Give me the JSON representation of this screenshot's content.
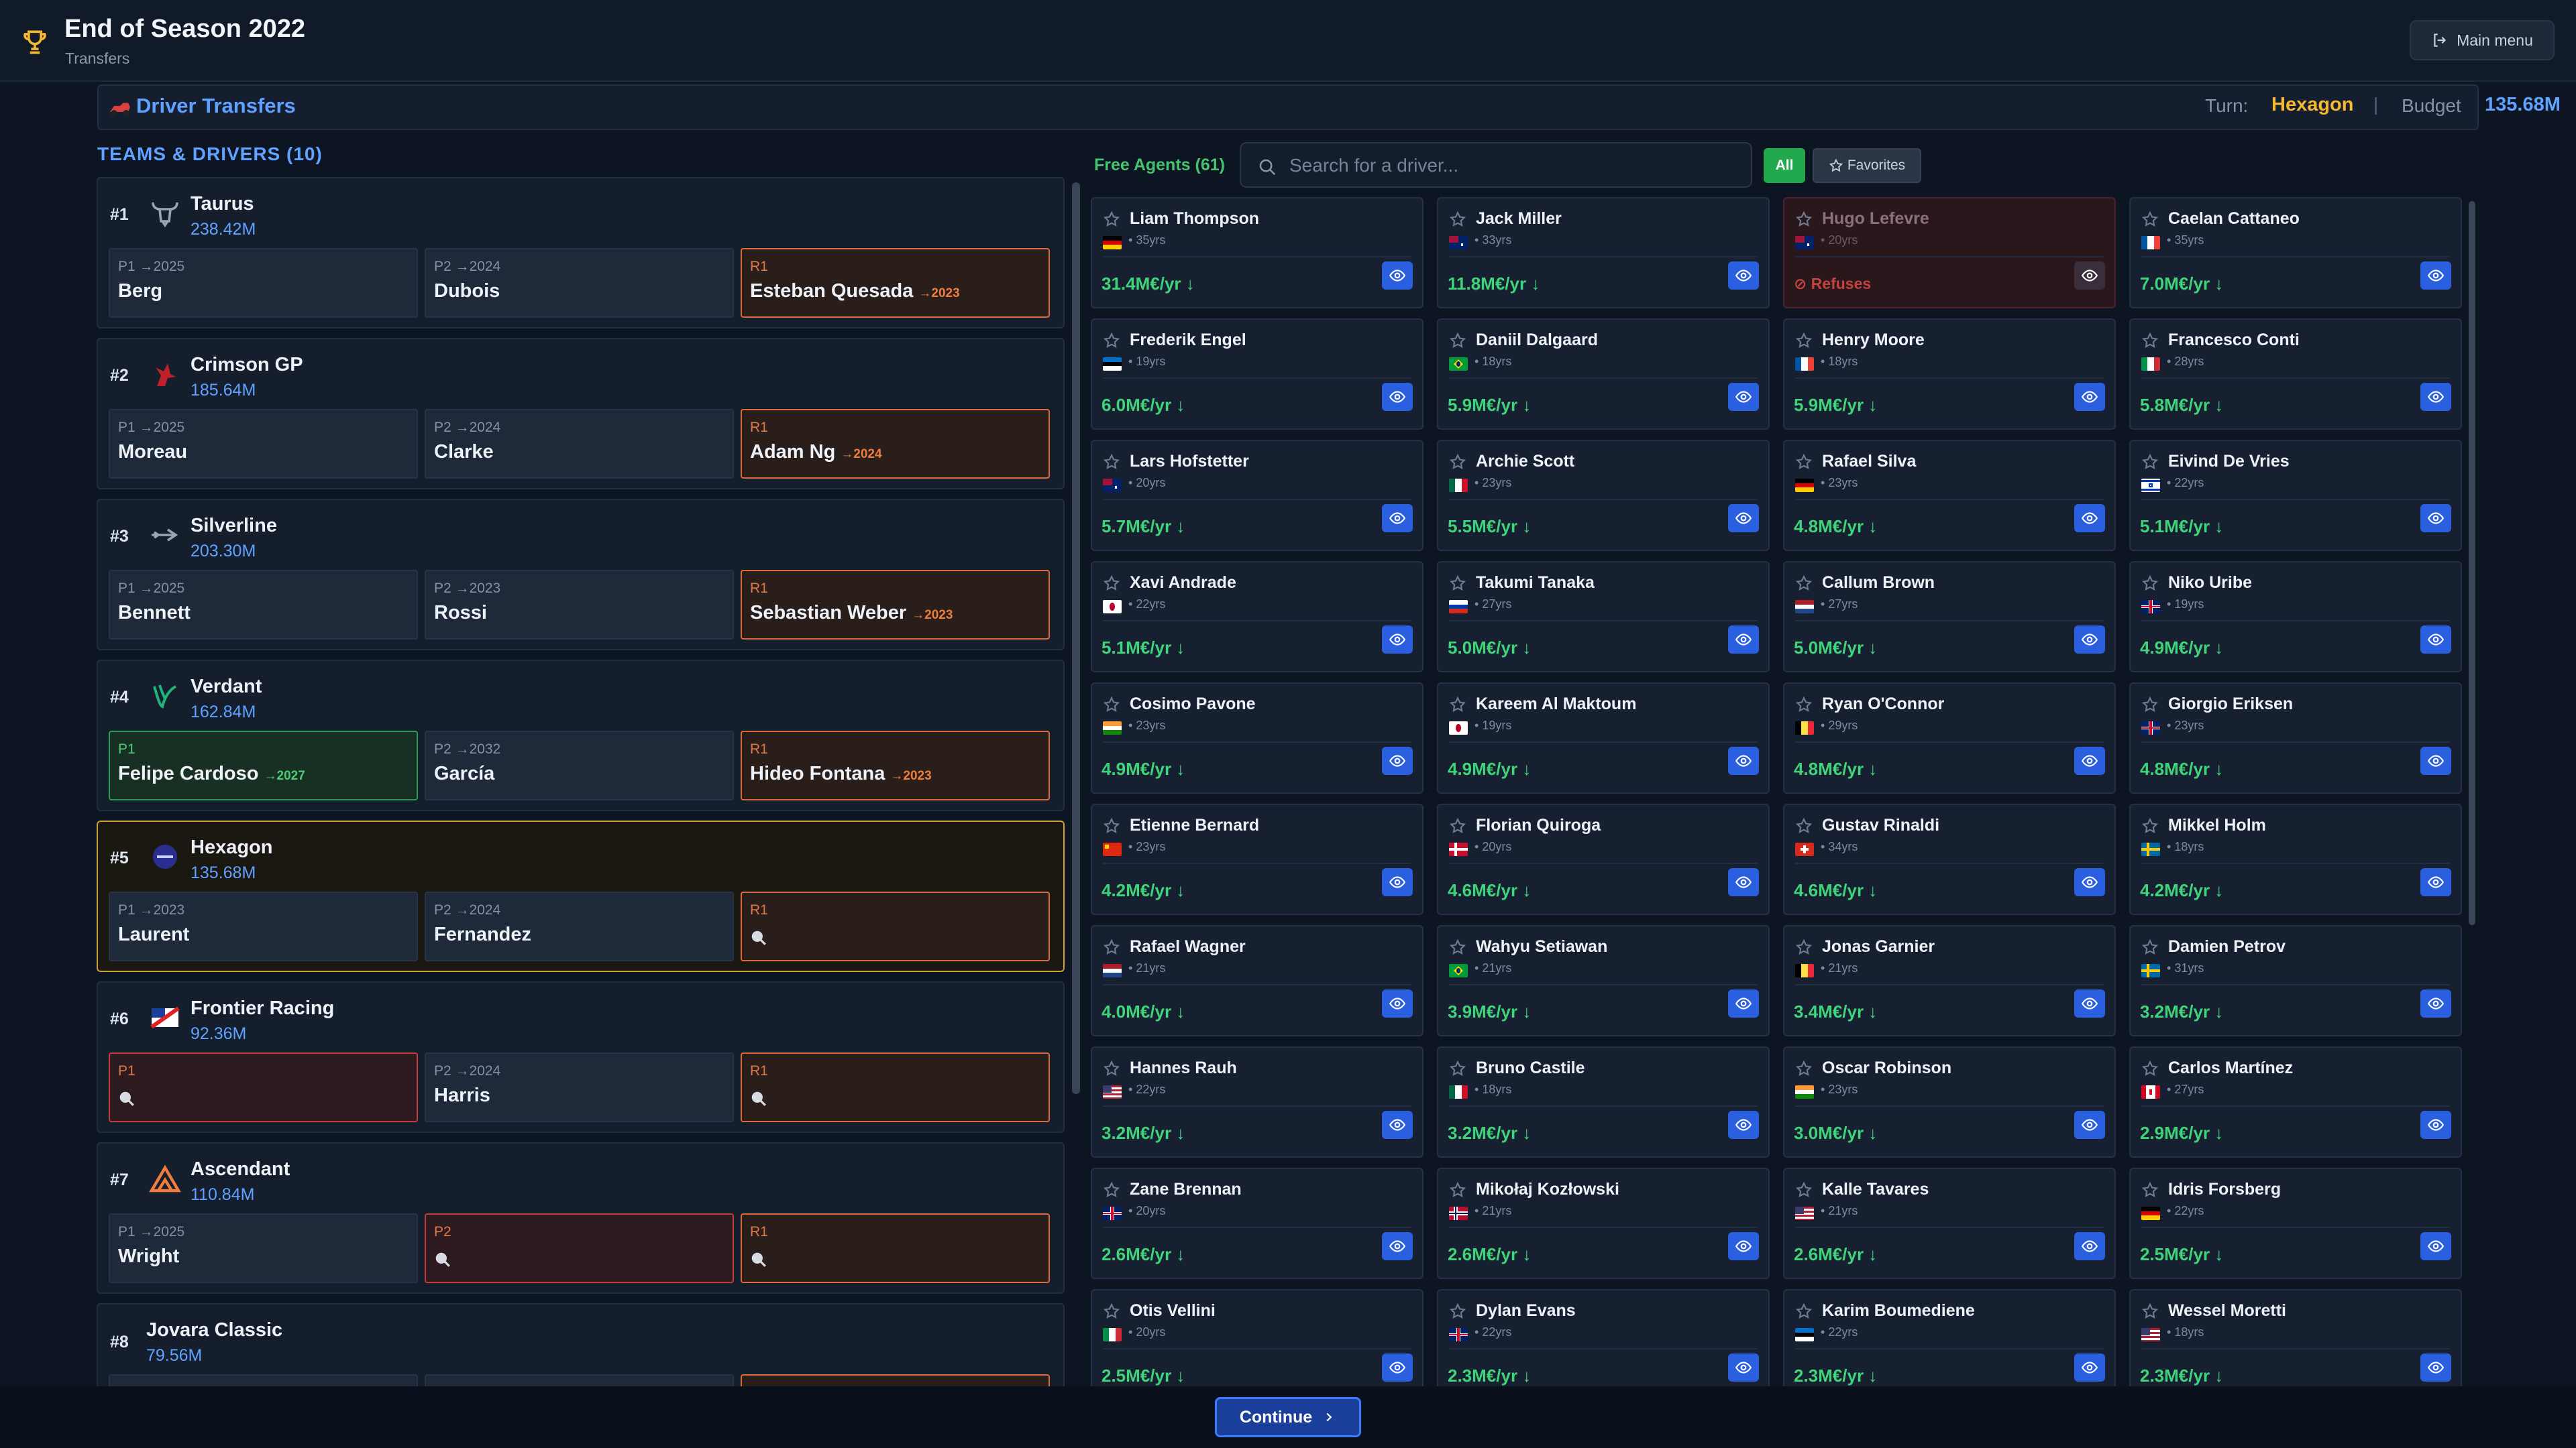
{
  "header": {
    "title": "End of Season 2022",
    "subtitle": "Transfers",
    "main_menu": "Main menu"
  },
  "transfers_bar": {
    "title": "Driver Transfers",
    "turn_label": "Turn:",
    "turn_value": "Hexagon",
    "separator": "|",
    "budget_label": "Budget",
    "budget_value": "135.68M"
  },
  "teams": {
    "header": "TEAMS & DRIVERS (10)",
    "list": [
      {
        "rank": "#1",
        "name": "Taurus",
        "budget": "238.42M",
        "logo": "bull-icon",
        "slots": [
          {
            "label": "P1 →2025",
            "driver": "Berg",
            "extra": "",
            "state": ""
          },
          {
            "label": "P2 →2024",
            "driver": "Dubois",
            "extra": "",
            "state": ""
          },
          {
            "label": "R1",
            "driver": "Esteban Quesada",
            "extra": "→2023",
            "state": "r"
          }
        ]
      },
      {
        "rank": "#2",
        "name": "Crimson GP",
        "budget": "185.64M",
        "logo": "crimson-horse-icon",
        "slots": [
          {
            "label": "P1 →2025",
            "driver": "Moreau",
            "extra": "",
            "state": ""
          },
          {
            "label": "P2 →2024",
            "driver": "Clarke",
            "extra": "",
            "state": ""
          },
          {
            "label": "R1",
            "driver": "Adam Ng",
            "extra": "→2024",
            "state": "r"
          }
        ]
      },
      {
        "rank": "#3",
        "name": "Silverline",
        "budget": "203.30M",
        "logo": "silver-arrow-icon",
        "slots": [
          {
            "label": "P1 →2025",
            "driver": "Bennett",
            "extra": "",
            "state": ""
          },
          {
            "label": "P2 →2023",
            "driver": "Rossi",
            "extra": "",
            "state": ""
          },
          {
            "label": "R1",
            "driver": "Sebastian Weber",
            "extra": "→2023",
            "state": "r"
          }
        ]
      },
      {
        "rank": "#4",
        "name": "Verdant",
        "budget": "162.84M",
        "logo": "verdant-leaf-icon",
        "slots": [
          {
            "label": "P1",
            "driver": "Felipe Cardoso",
            "extra": "→2027",
            "state": "g"
          },
          {
            "label": "P2 →2032",
            "driver": "García",
            "extra": "",
            "state": ""
          },
          {
            "label": "R1",
            "driver": "Hideo Fontana",
            "extra": "→2023",
            "state": "r"
          }
        ]
      },
      {
        "rank": "#5",
        "name": "Hexagon",
        "budget": "135.68M",
        "logo": "hexagon-badge-icon",
        "slots": [
          {
            "label": "P1 →2023",
            "driver": "Laurent",
            "extra": "",
            "state": ""
          },
          {
            "label": "P2 →2024",
            "driver": "Fernandez",
            "extra": "",
            "state": ""
          },
          {
            "label": "R1",
            "driver": "",
            "extra": "",
            "state": "r"
          }
        ]
      },
      {
        "rank": "#6",
        "name": "Frontier Racing",
        "budget": "92.36M",
        "logo": "frontier-flag-icon",
        "slots": [
          {
            "label": "P1",
            "driver": "",
            "extra": "",
            "state": "e"
          },
          {
            "label": "P2 →2024",
            "driver": "Harris",
            "extra": "",
            "state": ""
          },
          {
            "label": "R1",
            "driver": "",
            "extra": "",
            "state": "r"
          }
        ]
      },
      {
        "rank": "#7",
        "name": "Ascendant",
        "budget": "110.84M",
        "logo": "ascendant-peak-icon",
        "slots": [
          {
            "label": "P1 →2025",
            "driver": "Wright",
            "extra": "",
            "state": ""
          },
          {
            "label": "P2",
            "driver": "",
            "extra": "",
            "state": "e"
          },
          {
            "label": "R1",
            "driver": "",
            "extra": "",
            "state": "r"
          }
        ]
      },
      {
        "rank": "#8",
        "name": "Jovara Classic",
        "budget": "79.56M",
        "logo": "",
        "slots": [
          {
            "label": "",
            "driver": "",
            "extra": "",
            "state": ""
          },
          {
            "label": "",
            "driver": "",
            "extra": "",
            "state": ""
          },
          {
            "label": "",
            "driver": "",
            "extra": "",
            "state": "r"
          }
        ]
      }
    ]
  },
  "free_agents": {
    "header": "Free Agents (61)",
    "search_placeholder": "Search for a driver...",
    "filter_all": "All",
    "filter_favorites": "Favorites",
    "drivers": [
      {
        "name": "Liam Thompson",
        "age": "35yrs",
        "wage": "31.4M€/yr",
        "flag": "de"
      },
      {
        "name": "Jack Miller",
        "age": "33yrs",
        "wage": "11.8M€/yr",
        "flag": "au"
      },
      {
        "name": "Hugo Lefevre",
        "age": "20yrs",
        "wage": "Refuses",
        "flag": "au",
        "refuses": true
      },
      {
        "name": "Caelan Cattaneo",
        "age": "35yrs",
        "wage": "7.0M€/yr",
        "flag": "fr"
      },
      {
        "name": "Frederik Engel",
        "age": "19yrs",
        "wage": "6.0M€/yr",
        "flag": "ee"
      },
      {
        "name": "Daniil Dalgaard",
        "age": "18yrs",
        "wage": "5.9M€/yr",
        "flag": "br"
      },
      {
        "name": "Henry Moore",
        "age": "18yrs",
        "wage": "5.9M€/yr",
        "flag": "fr"
      },
      {
        "name": "Francesco Conti",
        "age": "28yrs",
        "wage": "5.8M€/yr",
        "flag": "it"
      },
      {
        "name": "Lars Hofstetter",
        "age": "20yrs",
        "wage": "5.7M€/yr",
        "flag": "au"
      },
      {
        "name": "Archie Scott",
        "age": "23yrs",
        "wage": "5.5M€/yr",
        "flag": "mx"
      },
      {
        "name": "Rafael Silva",
        "age": "23yrs",
        "wage": "4.8M€/yr",
        "flag": "de"
      },
      {
        "name": "Eivind De Vries",
        "age": "22yrs",
        "wage": "5.1M€/yr",
        "flag": "il"
      },
      {
        "name": "Xavi Andrade",
        "age": "22yrs",
        "wage": "5.1M€/yr",
        "flag": "jp"
      },
      {
        "name": "Takumi Tanaka",
        "age": "27yrs",
        "wage": "5.0M€/yr",
        "flag": "ru"
      },
      {
        "name": "Callum Brown",
        "age": "27yrs",
        "wage": "5.0M€/yr",
        "flag": "nl"
      },
      {
        "name": "Niko Uribe",
        "age": "19yrs",
        "wage": "4.9M€/yr",
        "flag": "gb"
      },
      {
        "name": "Cosimo Pavone",
        "age": "23yrs",
        "wage": "4.9M€/yr",
        "flag": "in"
      },
      {
        "name": "Kareem Al Maktoum",
        "age": "19yrs",
        "wage": "4.9M€/yr",
        "flag": "jp"
      },
      {
        "name": "Ryan O'Connor",
        "age": "29yrs",
        "wage": "4.8M€/yr",
        "flag": "be"
      },
      {
        "name": "Giorgio Eriksen",
        "age": "23yrs",
        "wage": "4.8M€/yr",
        "flag": "gb"
      },
      {
        "name": "Etienne Bernard",
        "age": "23yrs",
        "wage": "4.2M€/yr",
        "flag": "cn"
      },
      {
        "name": "Florian Quiroga",
        "age": "20yrs",
        "wage": "4.6M€/yr",
        "flag": "dk"
      },
      {
        "name": "Gustav Rinaldi",
        "age": "34yrs",
        "wage": "4.6M€/yr",
        "flag": "ch"
      },
      {
        "name": "Mikkel Holm",
        "age": "18yrs",
        "wage": "4.2M€/yr",
        "flag": "se"
      },
      {
        "name": "Rafael Wagner",
        "age": "21yrs",
        "wage": "4.0M€/yr",
        "flag": "nl"
      },
      {
        "name": "Wahyu Setiawan",
        "age": "21yrs",
        "wage": "3.9M€/yr",
        "flag": "br"
      },
      {
        "name": "Jonas Garnier",
        "age": "21yrs",
        "wage": "3.4M€/yr",
        "flag": "be"
      },
      {
        "name": "Damien Petrov",
        "age": "31yrs",
        "wage": "3.2M€/yr",
        "flag": "se"
      },
      {
        "name": "Hannes Rauh",
        "age": "22yrs",
        "wage": "3.2M€/yr",
        "flag": "us"
      },
      {
        "name": "Bruno Castile",
        "age": "18yrs",
        "wage": "3.2M€/yr",
        "flag": "mx"
      },
      {
        "name": "Oscar Robinson",
        "age": "23yrs",
        "wage": "3.0M€/yr",
        "flag": "in"
      },
      {
        "name": "Carlos Martínez",
        "age": "27yrs",
        "wage": "2.9M€/yr",
        "flag": "ca"
      },
      {
        "name": "Zane Brennan",
        "age": "20yrs",
        "wage": "2.6M€/yr",
        "flag": "gb"
      },
      {
        "name": "Mikołaj Kozłowski",
        "age": "21yrs",
        "wage": "2.6M€/yr",
        "flag": "no"
      },
      {
        "name": "Kalle Tavares",
        "age": "21yrs",
        "wage": "2.6M€/yr",
        "flag": "us"
      },
      {
        "name": "Idris Forsberg",
        "age": "22yrs",
        "wage": "2.5M€/yr",
        "flag": "de"
      },
      {
        "name": "Otis Vellini",
        "age": "20yrs",
        "wage": "2.5M€/yr",
        "flag": "it"
      },
      {
        "name": "Dylan Evans",
        "age": "22yrs",
        "wage": "2.3M€/yr",
        "flag": "gb"
      },
      {
        "name": "Karim Boumediene",
        "age": "22yrs",
        "wage": "2.3M€/yr",
        "flag": "ee"
      },
      {
        "name": "Wessel Moretti",
        "age": "18yrs",
        "wage": "2.3M€/yr",
        "flag": "us"
      }
    ]
  },
  "footer": {
    "continue_label": "Continue"
  },
  "colors": {
    "accent_blue": "#5fa2ff",
    "turn_gold": "#f5b82e",
    "wage_green": "#3fd37a",
    "reserve_orange": "#d96b3b",
    "empty_red": "#c53c3c"
  }
}
